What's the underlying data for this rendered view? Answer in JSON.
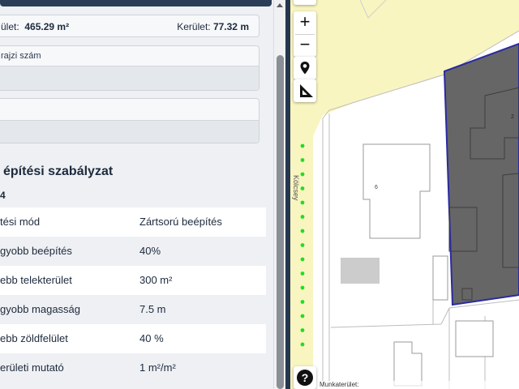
{
  "info": {
    "area_label": "ület:",
    "area_value": "465.29  m²",
    "perimeter_label": "Kerület:",
    "perimeter_value": "77.32 m",
    "field1_label": "rajzi szám"
  },
  "regulation": {
    "title": "építési szabályzat",
    "subtitle": "4",
    "rows": [
      {
        "key": "tési mód",
        "value": "Zártsorú beépítés"
      },
      {
        "key": "gyobb beépítés",
        "value": "40%"
      },
      {
        "key": "ebb telekterület",
        "value": "300 m²"
      },
      {
        "key": "gyobb magasság",
        "value": "7.5 m"
      },
      {
        "key": "ebb zöldfelület",
        "value": "40 %"
      },
      {
        "key": "erületi mutató",
        "value": "1 m²/m²"
      }
    ]
  },
  "map": {
    "zoom_in": "+",
    "zoom_out": "−",
    "help": "?",
    "attribution_text": "Munkaterület:",
    "attribution_link": "",
    "road_label": "Kölcsey",
    "parcel_number": "2",
    "building_number": "6",
    "colors": {
      "road": "#f9f5c0",
      "selected_fill": "#666666",
      "selected_outline": "#2a2aa0",
      "dots": "#22dd22"
    }
  }
}
